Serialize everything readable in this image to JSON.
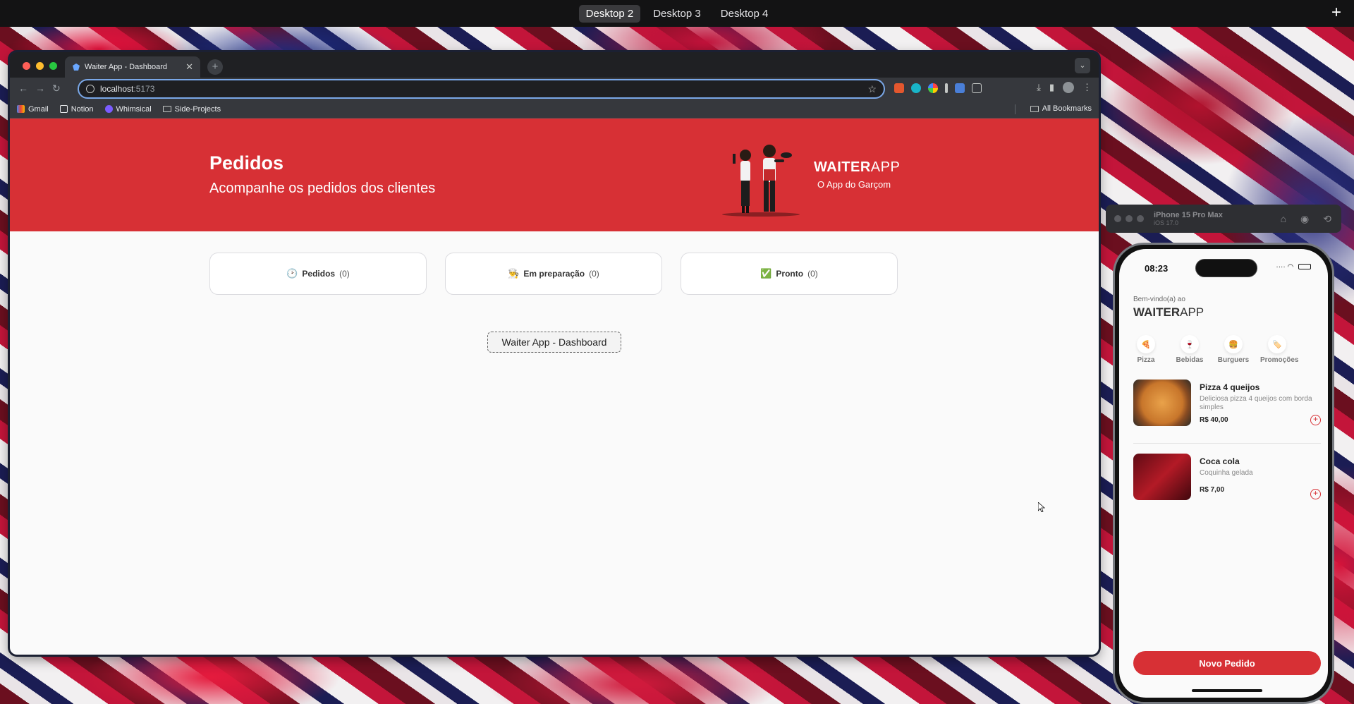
{
  "desktop": {
    "tabs": [
      "Desktop 2",
      "Desktop 3",
      "Desktop 4"
    ],
    "active_tab": "Desktop 2",
    "add_icon": "plus-icon"
  },
  "browser": {
    "tab_title": "Waiter App - Dashboard",
    "url_host": "localhost",
    "url_port": ":5173",
    "bookmarks": [
      "Gmail",
      "Notion",
      "Whimsical",
      "Side-Projects"
    ],
    "all_bookmarks": "All Bookmarks",
    "accent_color": "#7aa8e8"
  },
  "page": {
    "hero_title": "Pedidos",
    "hero_subtitle": "Acompanhe os pedidos dos clientes",
    "brand_bold": "WAITER",
    "brand_light": "APP",
    "brand_tagline": "O App do Garçom",
    "brand_color": "#d73035",
    "columns": [
      {
        "emoji": "🕑",
        "label": "Pedidos",
        "count": "(0)"
      },
      {
        "emoji": "👨‍🍳",
        "label": "Em preparação",
        "count": "(0)"
      },
      {
        "emoji": "✅",
        "label": "Pronto",
        "count": "(0)"
      }
    ],
    "title_chip": "Waiter App - Dashboard"
  },
  "simulator": {
    "device": "iPhone 15 Pro Max",
    "os": "iOS 17.0",
    "time": "08:23",
    "welcome": "Bem-vindo(a) ao",
    "brand_bold": "WAITER",
    "brand_light": "APP",
    "categories": [
      {
        "icon": "🍕",
        "label": "Pizza"
      },
      {
        "icon": "🍷",
        "label": "Bebidas"
      },
      {
        "icon": "🍔",
        "label": "Burguers"
      },
      {
        "icon": "🏷️",
        "label": "Promoções"
      }
    ],
    "products": [
      {
        "name": "Pizza 4 queijos",
        "description": "Deliciosa pizza 4 queijos com borda simples",
        "price": "R$ 40,00"
      },
      {
        "name": "Coca cola",
        "description": "Coquinha gelada",
        "price": "R$ 7,00"
      }
    ],
    "cta": "Novo Pedido"
  }
}
